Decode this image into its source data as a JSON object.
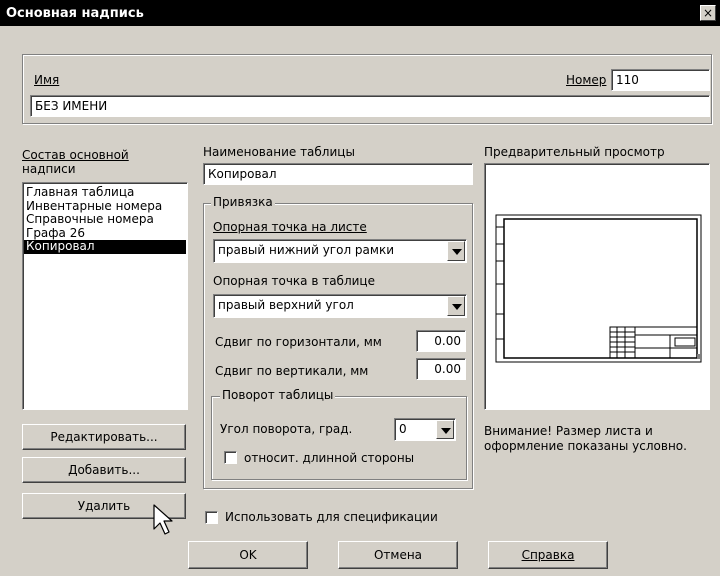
{
  "window": {
    "title": "Основная надпись",
    "close_label": "×"
  },
  "name_group": {
    "name_label": "Имя",
    "name_value": "БЕЗ ИМЕНИ",
    "number_label": "Номер",
    "number_value": "110"
  },
  "composition": {
    "label_line1": "Состав основной",
    "label_line2": "надписи",
    "items": [
      "Главная таблица",
      "Инвентарные номера",
      "Справочные номера",
      "Графа 26",
      "Копировал"
    ],
    "selected_index": 4,
    "edit_button": "Редактировать...",
    "add_button": "Добавить...",
    "delete_button": "Удалить"
  },
  "table_name": {
    "label": "Наименование таблицы",
    "value": "Копировал"
  },
  "binding": {
    "legend": "Привязка",
    "sheet_point_label": "Опорная точка на листе",
    "sheet_point_value": "правый нижний угол рамки",
    "table_point_label": "Опорная точка в таблице",
    "table_point_value": "правый верхний угол",
    "shift_h_label": "Сдвиг по горизонтали, мм",
    "shift_h_value": "0.00",
    "shift_v_label": "Сдвиг по вертикали, мм",
    "shift_v_value": "0.00"
  },
  "rotation": {
    "legend": "Поворот таблицы",
    "angle_label": "Угол поворота, град.",
    "angle_value": "0",
    "relative_label": "относит. длинной стороны",
    "relative_checked": false
  },
  "use_for_spec": {
    "label": "Использовать для спецификации",
    "checked": false
  },
  "preview": {
    "label": "Предварительный просмотр",
    "note_line1": "Внимание! Размер листа и",
    "note_line2": "оформление показаны условно."
  },
  "footer": {
    "ok": "OK",
    "cancel": "Отмена",
    "help": "Справка"
  }
}
